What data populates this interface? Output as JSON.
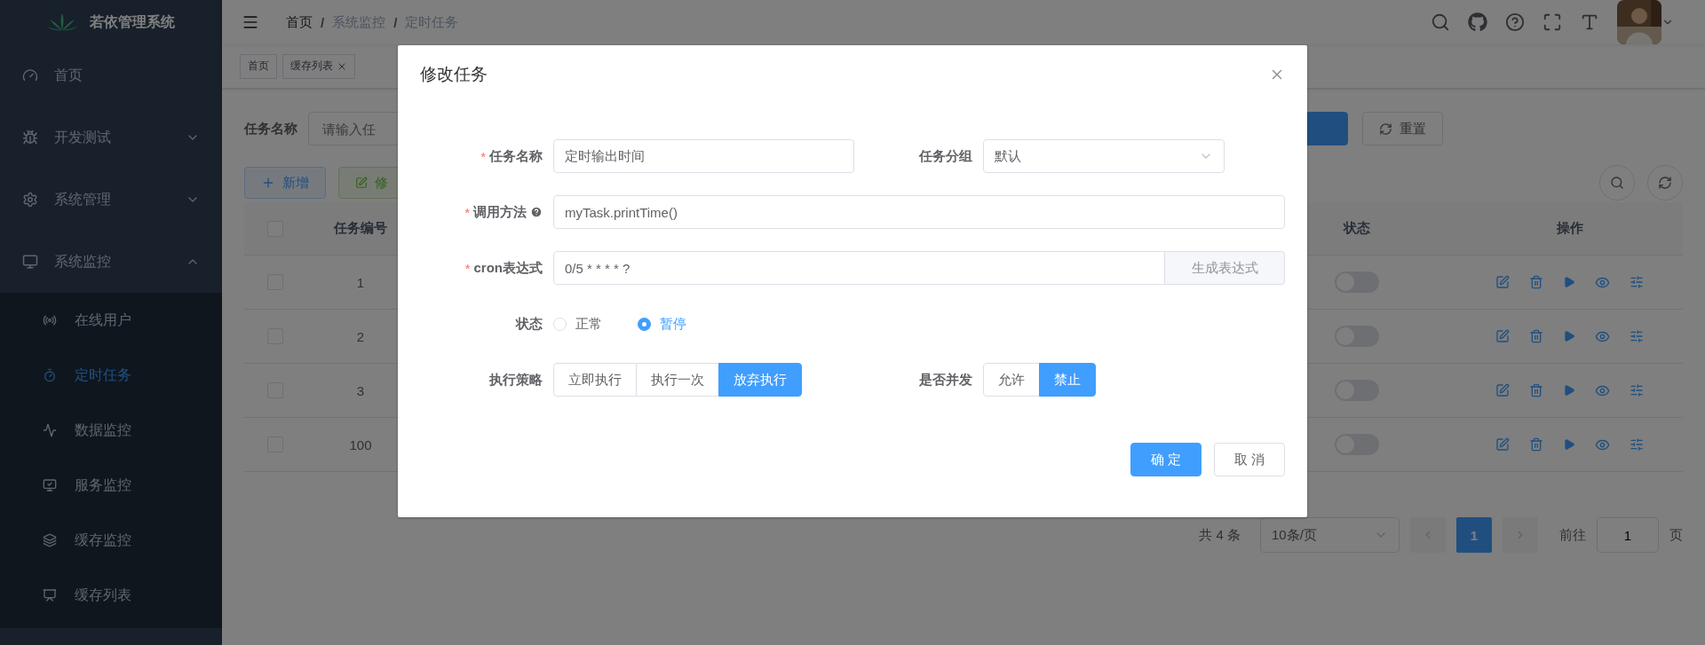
{
  "sidebar": {
    "title": "若依管理系统",
    "items": [
      {
        "label": "首页",
        "kind": "link"
      },
      {
        "label": "开发测试",
        "kind": "group",
        "expanded": false
      },
      {
        "label": "系统管理",
        "kind": "group",
        "expanded": false
      },
      {
        "label": "系统监控",
        "kind": "group",
        "expanded": true,
        "children": [
          {
            "label": "在线用户",
            "selected": false
          },
          {
            "label": "定时任务",
            "selected": true
          },
          {
            "label": "数据监控",
            "selected": false
          },
          {
            "label": "服务监控",
            "selected": false
          },
          {
            "label": "缓存监控",
            "selected": false
          },
          {
            "label": "缓存列表",
            "selected": false
          }
        ]
      }
    ]
  },
  "breadcrumb": [
    {
      "label": "首页",
      "current": false
    },
    {
      "separator": "/",
      "label": "系统监控",
      "current": true
    },
    {
      "separator": "/",
      "label": "定时任务",
      "current": true
    }
  ],
  "tags": [
    {
      "label": "首页",
      "closable": false
    },
    {
      "label": "缓存列表",
      "closable": true
    }
  ],
  "search": {
    "label": "任务名称",
    "placeholder": "请输入任",
    "reset_button": "重置"
  },
  "toolbar": [
    {
      "label": "新增",
      "kind": "add"
    },
    {
      "label": "修",
      "kind": "edit"
    }
  ],
  "table": {
    "columns": [
      "任务编号",
      "状态",
      "操作"
    ],
    "all_checked": false,
    "rows": [
      {
        "id": "1",
        "checked": false,
        "on": false
      },
      {
        "id": "2",
        "checked": false,
        "on": false
      },
      {
        "id": "3",
        "checked": false,
        "on": false
      },
      {
        "id": "100",
        "checked": false,
        "on": false
      }
    ]
  },
  "pagination": {
    "total": "共 4 条",
    "page_size": "10条/页",
    "pages": [
      {
        "label": "1",
        "selected": true
      }
    ],
    "goto_label": "前往",
    "goto_value": "1",
    "goto_suffix": "页"
  },
  "dialog": {
    "title": "修改任务",
    "rows": [
      [
        {
          "kind": "input",
          "required_mark": "*",
          "label": "任务名称",
          "value": "定时输出时间"
        },
        {
          "kind": "select",
          "label": "任务分组",
          "value": "默认"
        }
      ],
      [
        {
          "kind": "input",
          "required_mark": "*",
          "label": "调用方法",
          "hint_icon": true,
          "value": "myTask.printTime()"
        }
      ],
      [
        {
          "kind": "input_append",
          "required_mark": "*",
          "label": "cron表达式",
          "value": "0/5 * * * * ?",
          "append": "生成表达式"
        }
      ],
      [
        {
          "kind": "radio",
          "label": "状态",
          "options": [
            {
              "label": "正常",
              "selected": false
            },
            {
              "label": "暂停",
              "selected": true
            }
          ]
        }
      ],
      [
        {
          "kind": "button_group",
          "label": "执行策略",
          "options": [
            {
              "label": "立即执行",
              "selected": false
            },
            {
              "label": "执行一次",
              "selected": false
            },
            {
              "label": "放弃执行",
              "selected": true
            }
          ]
        },
        {
          "kind": "button_group",
          "label": "是否并发",
          "options": [
            {
              "label": "允许",
              "selected": false
            },
            {
              "label": "禁止",
              "selected": true
            }
          ]
        }
      ]
    ],
    "buttons": [
      {
        "label": "确 定",
        "kind": "primary"
      },
      {
        "label": "取 消",
        "kind": "default"
      }
    ]
  }
}
